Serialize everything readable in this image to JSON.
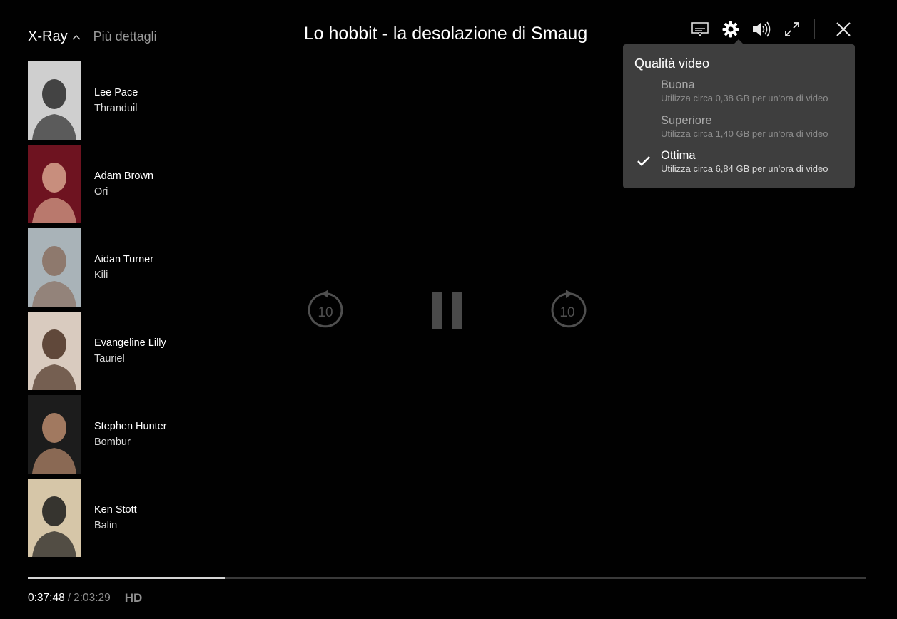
{
  "xray": {
    "title": "X-Ray",
    "more_details": "Più dettagli"
  },
  "movie": {
    "title": "Lo hobbit - la desolazione di Smaug"
  },
  "controls": {
    "icons": [
      "subtitles-icon",
      "settings-gear-icon",
      "volume-icon",
      "fullscreen-icon",
      "close-icon"
    ]
  },
  "cast": [
    {
      "actor": "Lee Pace",
      "role": "Thranduil",
      "photo_bg": "#cfcfcf",
      "photo_fg": "#2a2a2a"
    },
    {
      "actor": "Adam Brown",
      "role": "Ori",
      "photo_bg": "#6e1320",
      "photo_fg": "#d8a58e"
    },
    {
      "actor": "Aidan Turner",
      "role": "Kili",
      "photo_bg": "#a9b3b8",
      "photo_fg": "#8a6f5f"
    },
    {
      "actor": "Evangeline Lilly",
      "role": "Tauriel",
      "photo_bg": "#d9cbbf",
      "photo_fg": "#4a3122"
    },
    {
      "actor": "Stephen Hunter",
      "role": "Bombur",
      "photo_bg": "#1c1c1c",
      "photo_fg": "#b98a6c"
    },
    {
      "actor": "Ken Stott",
      "role": "Balin",
      "photo_bg": "#d6c6a8",
      "photo_fg": "#1a1a1a"
    }
  ],
  "playback": {
    "rewind_label": "10",
    "forward_label": "10"
  },
  "quality_menu": {
    "title": "Qualità video",
    "options": [
      {
        "label": "Buona",
        "desc": "Utilizza circa 0,38 GB per un'ora di video",
        "selected": false
      },
      {
        "label": "Superiore",
        "desc": "Utilizza circa 1,40 GB per un'ora di video",
        "selected": false
      },
      {
        "label": "Ottima",
        "desc": "Utilizza circa 6,84 GB per un'ora di video",
        "selected": true
      }
    ]
  },
  "progress": {
    "current": "0:37:48",
    "separator": "/",
    "duration": "2:03:29",
    "fraction": 0.2354,
    "quality_badge": "HD"
  },
  "colors": {
    "background": "#010101",
    "menu_bg": "#3e3e3e",
    "progress_fill": "#d4d4d4",
    "progress_track": "#3a3a3a"
  }
}
